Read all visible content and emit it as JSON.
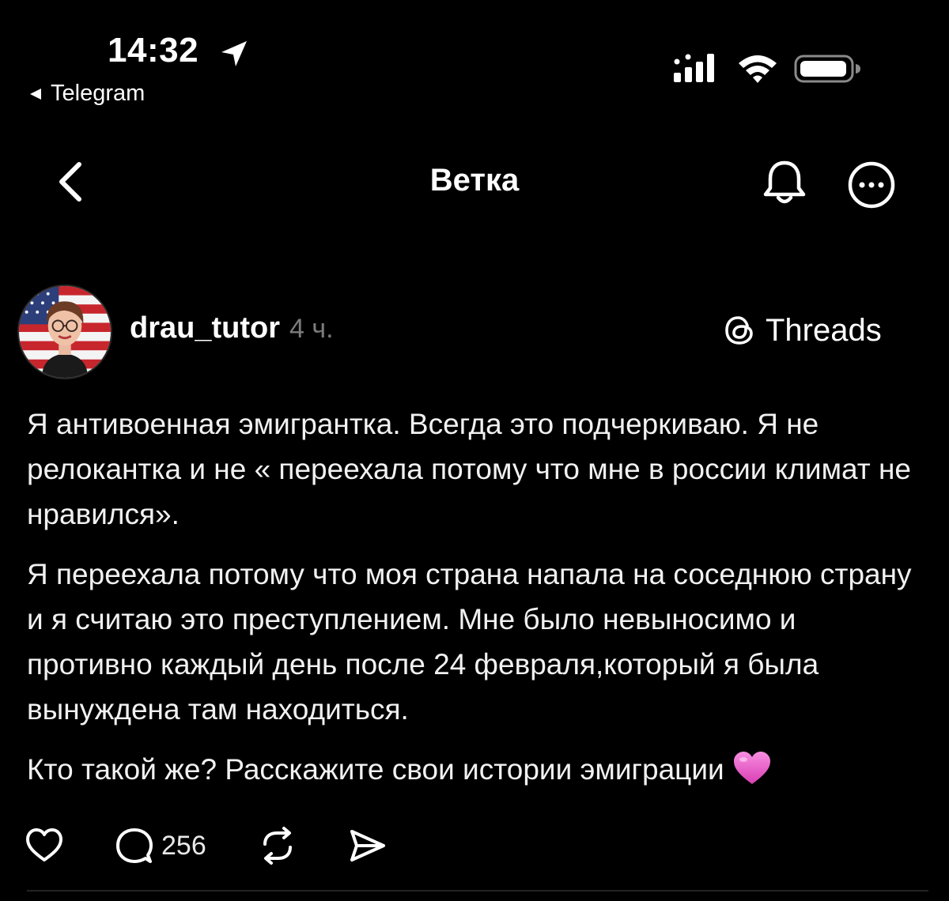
{
  "status_bar": {
    "time": "14:32",
    "back_app": "Telegram"
  },
  "header": {
    "title": "Ветка"
  },
  "post": {
    "username": "drau_tutor",
    "time_ago": "4 ч.",
    "platform_badge": "Threads",
    "paragraphs": [
      "Я антивоенная эмигрантка. Всегда это подчеркиваю. Я не релокантка и не « переехала потому что мне в россии климат не нравился».",
      "Я переехала потому что моя страна напала на соседнюю страну и я считаю это преступлением. Мне было невыносимо и противно каждый день после 24 февраля,который я была вынуждена там находиться.",
      "Кто такой же? Расскажите свои истории эмиграции"
    ],
    "emoji": "pink-heart",
    "reply_count": "256"
  },
  "icons": {
    "location": "location-arrow-icon",
    "back_app": "back-triangle-icon",
    "signal": "cellular-signal-icon",
    "wifi": "wifi-icon",
    "battery": "battery-icon",
    "nav_back": "chevron-left-icon",
    "bell": "bell-icon",
    "more": "more-options-icon",
    "threads": "threads-logo-icon",
    "like": "heart-icon",
    "reply": "comment-bubble-icon",
    "repost": "repost-icon",
    "share": "send-icon"
  },
  "colors": {
    "background": "#000000",
    "text": "#f1f1f1",
    "muted": "#7c7c7c",
    "emoji_pink": "#ec4fc8"
  }
}
